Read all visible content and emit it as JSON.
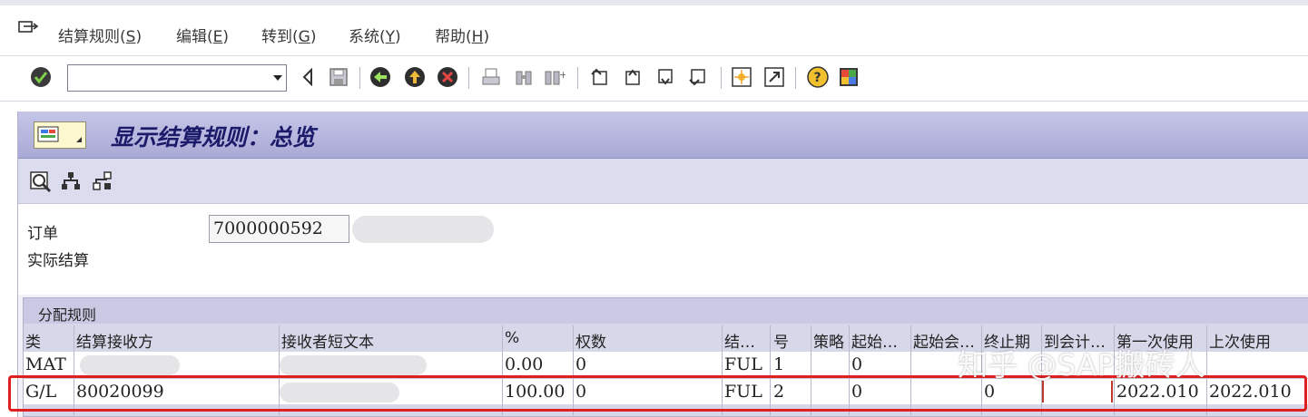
{
  "menu": {
    "items": [
      {
        "label": "结算规则(",
        "hot": "S",
        "end": ")"
      },
      {
        "label": "编辑(",
        "hot": "E",
        "end": ")"
      },
      {
        "label": "转到(",
        "hot": "G",
        "end": ")"
      },
      {
        "label": "系统(",
        "hot": "Y",
        "end": ")"
      },
      {
        "label": "帮助(",
        "hot": "H",
        "end": ")"
      }
    ]
  },
  "toolbar": {
    "command_value": ""
  },
  "screen": {
    "title": "显示结算规则：总览"
  },
  "header": {
    "order_label": "订单",
    "order_value": "7000000592",
    "settlement_label": "实际结算"
  },
  "table": {
    "title": "分配规则",
    "columns": [
      "类",
      "结算接收方",
      "接收者短文本",
      "%",
      "权数",
      "结…",
      "号",
      "策略",
      "起始…",
      "起始会…",
      "终止期",
      "到会计…",
      "第一次使用",
      "上次使用"
    ],
    "rows": [
      [
        "MAT",
        "",
        "",
        "0.00",
        "0",
        "FUL",
        "1",
        "",
        "0",
        "",
        "",
        "",
        "",
        ""
      ],
      [
        "G/L",
        "80020099",
        "",
        "100.00",
        "0",
        "FUL",
        "2",
        "",
        "0",
        "",
        "0",
        "",
        "2022.010",
        "2022.010"
      ]
    ]
  },
  "watermark": "知乎 @SAP搬砖人",
  "colors": {
    "title_bar": "#a9a9d6",
    "highlight": "#e02020"
  }
}
